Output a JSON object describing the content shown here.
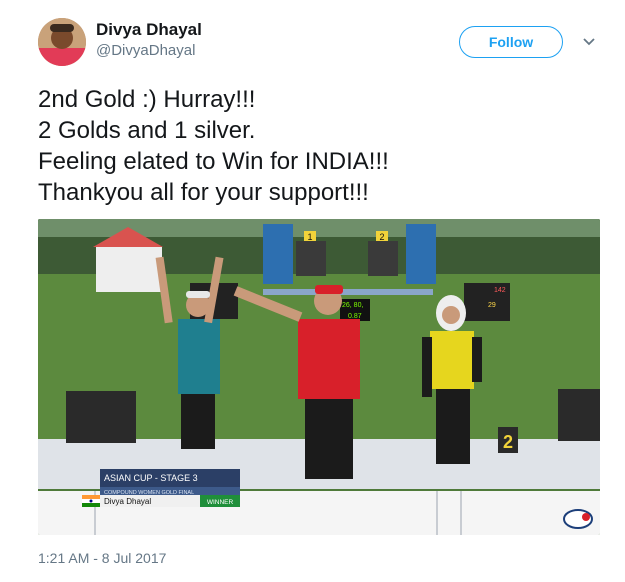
{
  "user": {
    "display_name": "Divya Dhayal",
    "handle": "@DivyaDhayal",
    "follow_label": "Follow"
  },
  "tweet": {
    "lines": [
      "2nd Gold :) Hurray!!!",
      "2 Golds and 1 silver.",
      "Feeling elated to Win for INDIA!!!",
      "Thankyou all for your support!!!"
    ],
    "timestamp": "1:21 AM - 8 Jul 2017"
  },
  "media": {
    "broadcast_title": "ASIAN CUP - STAGE 3",
    "broadcast_subtitle": "COMPOUND WOMEN GOLD FINAL",
    "athlete_name": "Divya Dhayal",
    "result": "WINNER",
    "target_numbers": [
      "1",
      "2"
    ],
    "podium_number": "2",
    "scoreboard_left": [
      "26, 80,",
      "0.87"
    ],
    "scoreboard_right": [
      "142",
      "29"
    ]
  },
  "colors": {
    "accent": "#1da1f2",
    "grass": "#4f7a3a",
    "broadcast_bar": "#2b3f66",
    "winner_green": "#1f8f3a"
  },
  "icons": {
    "menu": "chevron-down-icon",
    "flag": "india-flag-icon"
  }
}
